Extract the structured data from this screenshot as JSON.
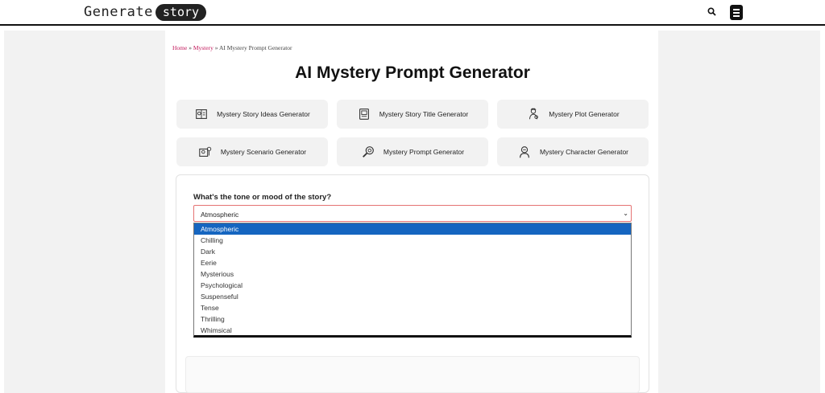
{
  "header": {
    "logo_text": "Generate",
    "logo_pill": "story",
    "search_icon": "search-icon",
    "menu_icon": "menu-icon"
  },
  "breadcrumb": {
    "home": "Home",
    "sep": " » ",
    "category": "Mystery",
    "current": "AI Mystery Prompt Generator"
  },
  "page_title": "AI Mystery Prompt Generator",
  "cards": [
    {
      "label": "Mystery Story Ideas Generator",
      "icon": "idea-book-icon"
    },
    {
      "label": "Mystery Story Title Generator",
      "icon": "title-book-icon"
    },
    {
      "label": "Mystery Plot Generator",
      "icon": "detective-icon"
    },
    {
      "label": "Mystery Scenario Generator",
      "icon": "scenario-icon"
    },
    {
      "label": "Mystery Prompt Generator",
      "icon": "magnifier-icon"
    },
    {
      "label": "Mystery Character Generator",
      "icon": "character-icon"
    }
  ],
  "form": {
    "tone_label": "What's the tone or mood of the story?",
    "tone_value": "Atmospheric",
    "tone_options": [
      "Atmospheric",
      "Chilling",
      "Dark",
      "Eerie",
      "Mysterious",
      "Psychological",
      "Suspenseful",
      "Tense",
      "Thrilling",
      "Whimsical"
    ]
  },
  "colors": {
    "link": "#c2185b",
    "selected_option": "#1565c0",
    "select_border": "#e57373"
  }
}
